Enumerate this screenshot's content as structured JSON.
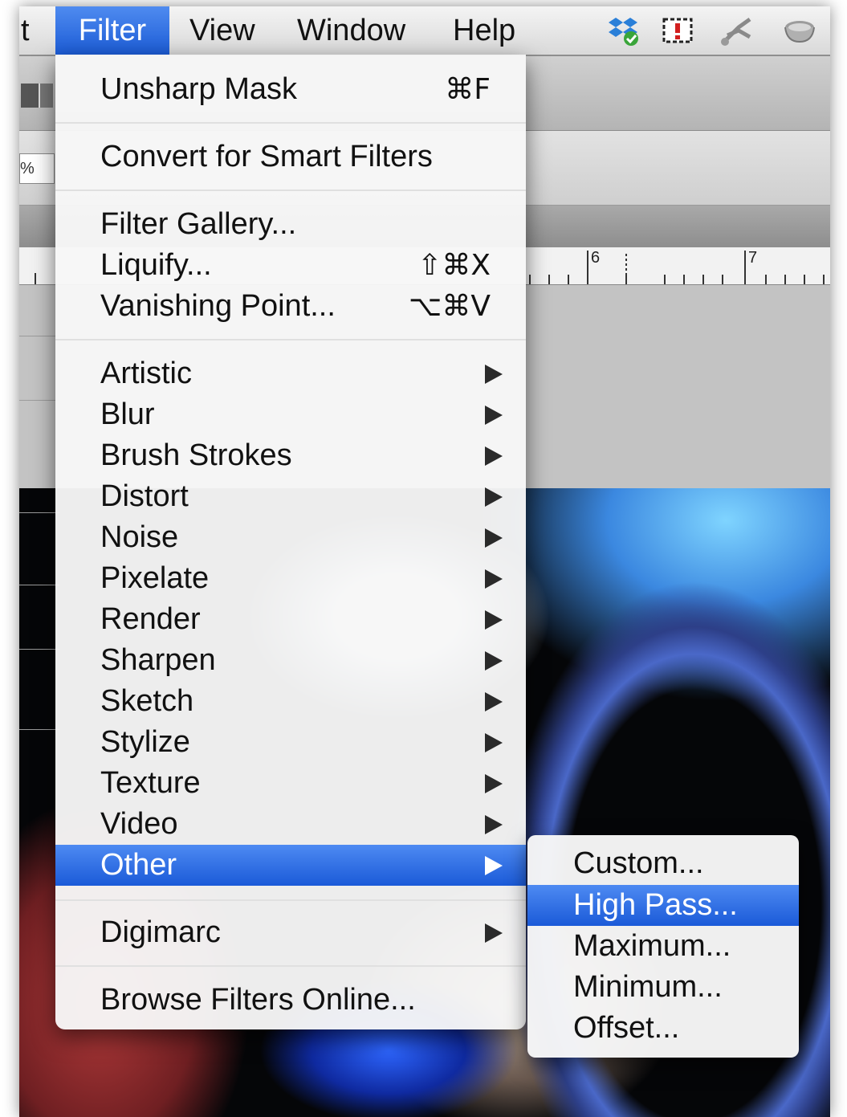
{
  "menubar": {
    "items": [
      {
        "label": "t"
      },
      {
        "label": "Filter"
      },
      {
        "label": "View"
      },
      {
        "label": "Window"
      },
      {
        "label": "Help"
      }
    ],
    "status_icons": [
      "dropbox-icon",
      "screen-capture-icon",
      "scissors-icon",
      "cup-icon"
    ]
  },
  "toolbar": {
    "zoom_value": "%"
  },
  "ruler": {
    "labels": [
      "6",
      "7"
    ]
  },
  "filter_menu": {
    "items": [
      {
        "label": "Unsharp Mask",
        "shortcut": "⌘F"
      },
      {
        "label": "Convert for Smart Filters",
        "shortcut": ""
      },
      {
        "label": "Filter Gallery...",
        "shortcut": ""
      },
      {
        "label": "Liquify...",
        "shortcut": "⇧⌘X"
      },
      {
        "label": "Vanishing Point...",
        "shortcut": "⌥⌘V"
      },
      {
        "label": "Artistic"
      },
      {
        "label": "Blur"
      },
      {
        "label": "Brush Strokes"
      },
      {
        "label": "Distort"
      },
      {
        "label": "Noise"
      },
      {
        "label": "Pixelate"
      },
      {
        "label": "Render"
      },
      {
        "label": "Sharpen"
      },
      {
        "label": "Sketch"
      },
      {
        "label": "Stylize"
      },
      {
        "label": "Texture"
      },
      {
        "label": "Video"
      },
      {
        "label": "Other"
      },
      {
        "label": "Digimarc"
      },
      {
        "label": "Browse Filters Online..."
      }
    ],
    "highlighted": "Other"
  },
  "other_submenu": {
    "items": [
      {
        "label": "Custom..."
      },
      {
        "label": "High Pass..."
      },
      {
        "label": "Maximum..."
      },
      {
        "label": "Minimum..."
      },
      {
        "label": "Offset..."
      }
    ],
    "highlighted": "High Pass..."
  },
  "colors": {
    "highlight": "#1f5fd9",
    "menubar": "#e6e6e6",
    "menu_bg": "#f7f7f7"
  }
}
